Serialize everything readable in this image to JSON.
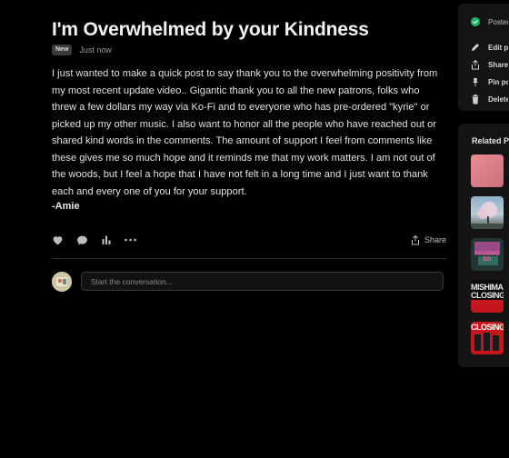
{
  "post": {
    "title": "I'm Overwhelmed by your Kindness",
    "badge": "New",
    "timestamp": "Just now",
    "body": "I just wanted to make a quick post to say thank you to the overwhelming positivity from my most recent update video.. Gigantic thank you to all the new patrons, folks who threw a few dollars my way via Ko-Fi and to everyone who has pre-ordered \"kyrie\" or picked up my other music. I also want to honor all the people who have reached out or shared kind words in the comments. The amount of support I feel from comments like these gives me so much hope and it reminds me that my work matters. I am not out of the woods, but I feel a hope that I have not felt in a long time and I just want to thank each and every one of you for your support.",
    "signature": "-Amie",
    "share_label": "Share"
  },
  "comment": {
    "placeholder": "Start the conversation..."
  },
  "sidebar_menu": {
    "status": "Posted",
    "items": [
      {
        "label": "Edit post",
        "icon": "pencil-icon"
      },
      {
        "label": "Share",
        "icon": "share-icon"
      },
      {
        "label": "Pin post",
        "icon": "pin-icon"
      },
      {
        "label": "Delete",
        "icon": "trash-icon"
      }
    ]
  },
  "related": {
    "title": "Related Posts",
    "thumbs": [
      {
        "text": ""
      },
      {
        "text": ""
      },
      {
        "text": "PAUSING DO"
      },
      {
        "text": "MISHIMA CLOSING"
      },
      {
        "text": "CLOSING"
      }
    ]
  },
  "colors": {
    "posted_check": "#1fb86a",
    "background": "#000000",
    "panel": "#141414"
  }
}
